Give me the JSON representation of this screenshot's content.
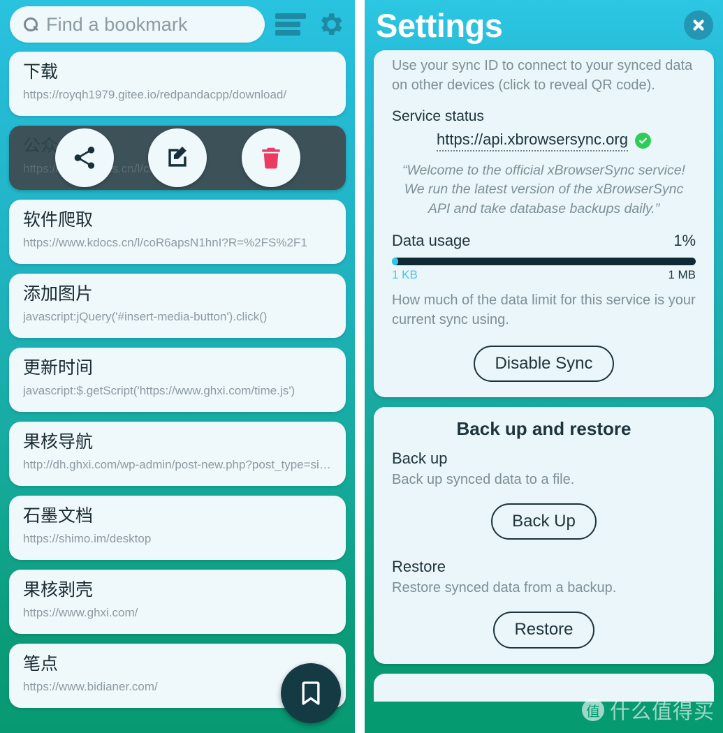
{
  "left": {
    "search": {
      "placeholder": "Find a bookmark",
      "icon": "search-icon"
    },
    "menu_icon": "hamburger-icon",
    "settings_icon": "gear-icon",
    "fab_icon": "bookmark-icon",
    "actions": [
      {
        "name": "share-button",
        "icon": "share-icon"
      },
      {
        "name": "edit-button",
        "icon": "edit-icon"
      },
      {
        "name": "delete-button",
        "icon": "trash-icon"
      }
    ],
    "bookmarks": [
      {
        "title": "下载",
        "url": "https://royqh1979.gitee.io/redpandacpp/download/",
        "selected": false
      },
      {
        "title": "公众号列表",
        "url": "https://www.kdocs.cn/l/cnNwDg?R",
        "selected": true
      },
      {
        "title": "软件爬取",
        "url": "https://www.kdocs.cn/l/coR6apsN1hnI?R=%2FS%2F1",
        "selected": false
      },
      {
        "title": "添加图片",
        "url": "javascript:jQuery('#insert-media-button').click()",
        "selected": false
      },
      {
        "title": "更新时间",
        "url": "javascript:$.getScript('https://www.ghxi.com/time.js')",
        "selected": false
      },
      {
        "title": "果核导航",
        "url": "http://dh.ghxi.com/wp-admin/post-new.php?post_type=sit…",
        "selected": false
      },
      {
        "title": "石墨文档",
        "url": "https://shimo.im/desktop",
        "selected": false
      },
      {
        "title": "果核剥壳",
        "url": "https://www.ghxi.com/",
        "selected": false
      },
      {
        "title": "笔点",
        "url": "https://www.bidianer.com/",
        "selected": false
      }
    ]
  },
  "right": {
    "header": {
      "title": "Settings",
      "close_icon": "close-icon"
    },
    "sync": {
      "description": "Use your sync ID to connect to your synced data on other devices (click to reveal QR code).",
      "service_status_label": "Service status",
      "service_url": "https://api.xbrowsersync.org",
      "status_icon": "check-circle-icon",
      "service_quote": "“Welcome to the official xBrowserSync service! We run the latest version of the xBrowserSync API and take database backups daily.”",
      "data_usage_label": "Data usage",
      "data_usage_percent": "1%",
      "progress_fill_percent": 2,
      "scale_min": "1 KB",
      "scale_max": "1 MB",
      "usage_help": "How much of the data limit for this service is your current sync using.",
      "disable_button": "Disable Sync"
    },
    "backup": {
      "heading": "Back up and restore",
      "backup_label": "Back up",
      "backup_desc": "Back up synced data to a file.",
      "backup_button": "Back Up",
      "restore_label": "Restore",
      "restore_desc": "Restore synced data from a backup.",
      "restore_button": "Restore"
    }
  },
  "watermark": {
    "badge": "值",
    "text": "什么值得买"
  },
  "colors": {
    "panel_top": "#2cc7e3",
    "panel_bottom": "#059a6f",
    "card": "#eaf6f9",
    "selected_card": "#3d5158",
    "dark_text": "#1e333b",
    "muted_text": "#7d8e96",
    "accent_cyan": "#2cc7e3",
    "delete_red": "#ec3a63",
    "status_green": "#2ecc5a",
    "fab": "#143a44"
  }
}
